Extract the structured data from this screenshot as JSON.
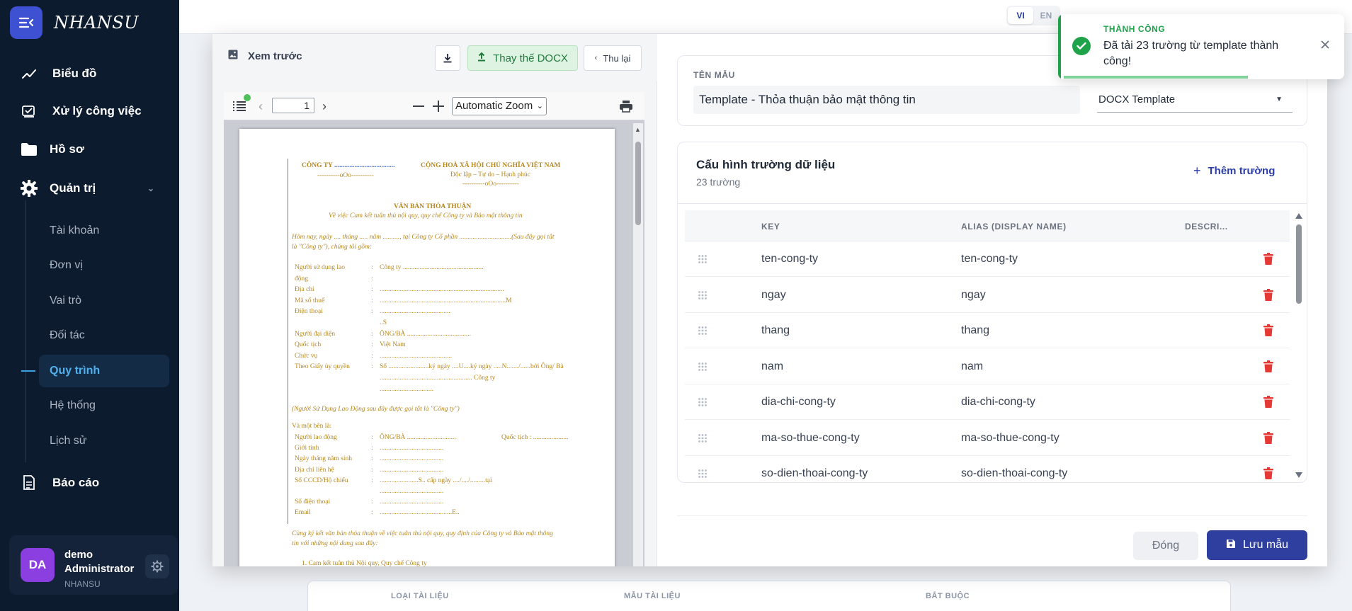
{
  "brand": {
    "name": "NHANSU"
  },
  "sidebar": {
    "items": [
      {
        "label": "Biểu đồ",
        "icon": "chart-line-icon"
      },
      {
        "label": "Xử lý công việc",
        "icon": "task-icon"
      },
      {
        "label": "Hồ sơ",
        "icon": "folder-icon"
      },
      {
        "label": "Quản trị",
        "icon": "gear-icon"
      }
    ],
    "sub_items": [
      "Tài khoản",
      "Đơn vị",
      "Vai trò",
      "Đối tác",
      "Quy trình",
      "Hệ thống",
      "Lịch sử"
    ],
    "active_sub": "Quy trình",
    "report": {
      "label": "Báo cáo",
      "icon": "report-icon"
    }
  },
  "user": {
    "initials": "DA",
    "name_line1": "demo",
    "name_line2": "Administrator",
    "org": "NHANSU"
  },
  "topbar": {
    "lang_vi": "VI",
    "lang_en": "EN"
  },
  "preview": {
    "title": "Xem trước",
    "replace_label": "Thay thế DOCX",
    "collapse_label": "Thu lại",
    "page_number": "1",
    "zoom": "Automatic Zoom"
  },
  "doc": {
    "company": "CÔNG TY",
    "nation": "CỘNG HOÀ XÃ HỘI CHỦ NGHĨA VIỆT NAM",
    "motto": "Độc lập – Tự do – Hạnh phúc",
    "ooo": "----------oOo----------",
    "doc_title": "VĂN BẢN THỎA THUẬN",
    "doc_subtitle": "Về việc Cam kết tuân thủ nội quy, quy chế Công ty và Bảo mật thông tin",
    "intro1": "Hôm nay, ngày ....  tháng .....  năm .........., tại Công ty Cổ phần ...............................(Sau đây gọi tắt",
    "intro2": "là \"Công ty\"), chúng tôi gồm:",
    "employer_rows": [
      {
        "label": "Người sử dụng lao",
        "value": "Công ty ................................................"
      },
      {
        "label": "động",
        "value": ""
      },
      {
        "label": "Địa chỉ",
        "value": ".........................................................................."
      },
      {
        "label": "Mã số thuế",
        "value": "...........................................................................M"
      },
      {
        "label": "Điện thoại",
        "value": ".........................................."
      },
      {
        "label": "",
        "value": "..S"
      },
      {
        "label": "Người đại diện",
        "value": "ÔNG/BÀ ......................................"
      },
      {
        "label": "Quốc tịch",
        "value": "Việt Nam"
      },
      {
        "label": "Chức vụ",
        "value": "..........................................."
      },
      {
        "label": "Theo Giấy ủy quyền",
        "value": "Số ........................ký ngày ....U....ký ngày .....N......./......bởi Ông/ Bà"
      },
      {
        "label": "",
        "value": "....................................................... Công ty"
      },
      {
        "label": "",
        "value": "................................"
      }
    ],
    "note1": "(Người Sử Dụng Lao Động sau đây được gọi tắt là \"Công ty\")",
    "party_b": "Và một bên là:",
    "employee_rows": [
      {
        "label": "Người lao động",
        "value": "ÔNG/BÀ .............................",
        "extra": "Quốc tịch    :   ....................."
      },
      {
        "label": "Giới tính",
        "value": "......................................"
      },
      {
        "label": "Ngày tháng năm sinh",
        "value": "......................................"
      },
      {
        "label": "Địa chỉ liên hệ",
        "value": "......................................"
      },
      {
        "label": "Số CCCD/Hộ chiếu",
        "value": ".......................S.. cấp ngày ..../..../.........tại"
      },
      {
        "label": "",
        "value": "......................................"
      },
      {
        "label": "Số điện thoại",
        "value": "......................................"
      },
      {
        "label": "Email",
        "value": "...........................................E.."
      }
    ],
    "agree1": "Cùng ký kết văn bản thỏa thuận về việc tuân thủ nội quy, quy định của Công ty và Bảo mật thông",
    "agree2": "tin với những nội dung sau đây:",
    "item1": "1.   Cam kết tuân thủ Nội quy, Quy chế Công ty"
  },
  "template": {
    "label_name": "TÊN MẪU",
    "name": "Template - Thỏa thuận bảo mật thông tin",
    "type": "DOCX Template"
  },
  "fields": {
    "title": "Cấu hình trường dữ liệu",
    "count": "23 trường",
    "add_label": "Thêm trường",
    "columns": [
      "KEY",
      "ALIAS (DISPLAY NAME)",
      "DESCRI..."
    ],
    "rows": [
      {
        "key": "ten-cong-ty",
        "alias": "ten-cong-ty"
      },
      {
        "key": "ngay",
        "alias": "ngay"
      },
      {
        "key": "thang",
        "alias": "thang"
      },
      {
        "key": "nam",
        "alias": "nam"
      },
      {
        "key": "dia-chi-cong-ty",
        "alias": "dia-chi-cong-ty"
      },
      {
        "key": "ma-so-thue-cong-ty",
        "alias": "ma-so-thue-cong-ty"
      },
      {
        "key": "so-dien-thoai-cong-ty",
        "alias": "so-dien-thoai-cong-ty"
      }
    ]
  },
  "footer": {
    "close_label": "Đóng",
    "save_label": "Lưu mẫu"
  },
  "background_form": {
    "col1": "LOẠI TÀI LIỆU",
    "col2": "MẪU TÀI LIỆU",
    "col3": "BẮT BUỘC"
  },
  "toast": {
    "title": "THÀNH CÔNG",
    "message": "Đã tải 23 trường từ template thành công!"
  },
  "colors": {
    "primary": "#2f3f9f",
    "success": "#1ea34a",
    "danger": "#e53935",
    "sidebar": "#0d1b2e"
  }
}
